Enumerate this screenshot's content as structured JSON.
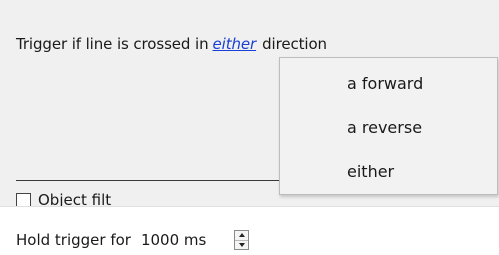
{
  "trigger": {
    "prefix": "Trigger if line is crossed in",
    "direction_link": "either",
    "suffix": "direction"
  },
  "direction_menu": {
    "options": [
      "a forward",
      "a reverse",
      "either"
    ]
  },
  "object_filter": {
    "label": "Object filt",
    "checked": false
  },
  "hold_trigger": {
    "label": "Hold trigger for",
    "value": "1000 ms"
  },
  "colors": {
    "panel_bg": "#f0f0f0",
    "link": "#1a3fd6",
    "menu_bg": "#f2f2f2"
  }
}
